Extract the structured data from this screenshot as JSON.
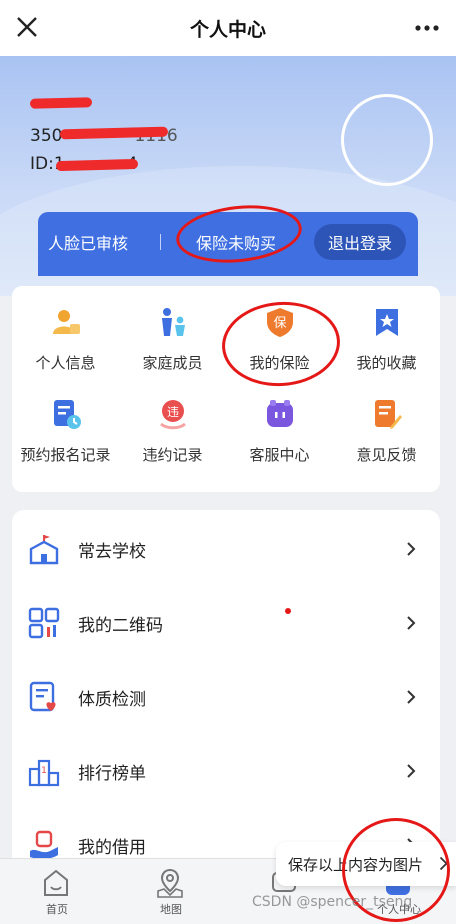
{
  "topbar": {
    "title": "个人中心"
  },
  "profile": {
    "phone_prefix": "350",
    "phone_suffix": "1116",
    "id_prefix": "ID:",
    "id_digits": "1",
    "id_tail": "4"
  },
  "status": {
    "face": "人脸已审核",
    "insurance": "保险未购买",
    "logout": "退出登录"
  },
  "grid": [
    {
      "label": "个人信息",
      "icon": "user-info-icon"
    },
    {
      "label": "家庭成员",
      "icon": "family-icon"
    },
    {
      "label": "我的保险",
      "icon": "insurance-icon"
    },
    {
      "label": "我的收藏",
      "icon": "bookmark-icon"
    },
    {
      "label": "预约报名记录",
      "icon": "appointment-icon"
    },
    {
      "label": "违约记录",
      "icon": "violation-icon"
    },
    {
      "label": "客服中心",
      "icon": "service-icon"
    },
    {
      "label": "意见反馈",
      "icon": "feedback-icon"
    }
  ],
  "list": [
    {
      "label": "常去学校",
      "icon": "school-icon"
    },
    {
      "label": "我的二维码",
      "icon": "qrcode-icon"
    },
    {
      "label": "体质检测",
      "icon": "health-check-icon"
    },
    {
      "label": "排行榜单",
      "icon": "ranking-icon"
    },
    {
      "label": "我的借用",
      "icon": "borrow-icon"
    }
  ],
  "tabs": [
    {
      "label": "首页",
      "icon": "home-icon"
    },
    {
      "label": "地图",
      "icon": "map-icon"
    },
    {
      "label": "",
      "icon": "message-icon"
    },
    {
      "label": "个人中心",
      "icon": "profile-icon"
    }
  ],
  "toast": {
    "text": "保存以上内容为图片"
  },
  "watermark": "CSDN @spencer_tseng",
  "colors": {
    "accent": "#3f6fe0",
    "annotation": "#e51818"
  }
}
